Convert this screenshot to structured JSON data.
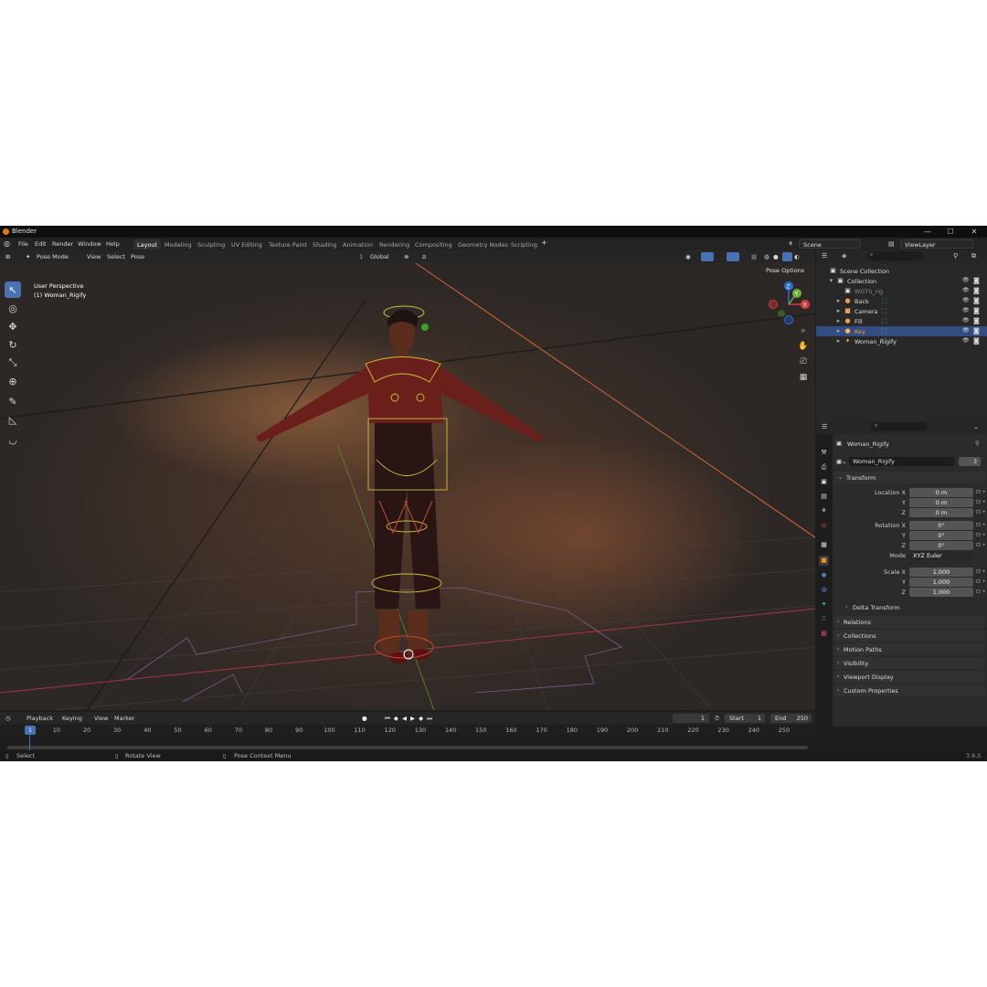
{
  "window": {
    "title": "Blender",
    "minimize": "—",
    "maximize": "☐",
    "close": "✕"
  },
  "menu": [
    "File",
    "Edit",
    "Render",
    "Window",
    "Help"
  ],
  "workspaces": [
    "Layout",
    "Modeling",
    "Sculpting",
    "UV Editing",
    "Texture Paint",
    "Shading",
    "Animation",
    "Rendering",
    "Compositing",
    "Geometry Nodes",
    "Scripting"
  ],
  "active_workspace": "Layout",
  "add_workspace": "+",
  "scene_field": "Scene",
  "view_layer_field": "ViewLayer",
  "viewport_header": {
    "mode": "Pose Mode",
    "menus": [
      "View",
      "Select",
      "Pose"
    ],
    "orientation": "Global",
    "pose_options": "Pose Options"
  },
  "viewport": {
    "perspective": "User Perspective",
    "object": "(1) Woman_Rigify",
    "gizmo": {
      "z": "Z",
      "y": "Y",
      "x": "X"
    }
  },
  "tools": [
    {
      "name": "select-box-tool",
      "glyph": "↖",
      "active": true
    },
    {
      "name": "cursor-tool",
      "glyph": "◎",
      "active": false
    },
    {
      "name": "move-tool",
      "glyph": "✥",
      "active": false
    },
    {
      "name": "rotate-tool",
      "glyph": "↻",
      "active": false
    },
    {
      "name": "scale-tool",
      "glyph": "⤡",
      "active": false
    },
    {
      "name": "transform-tool",
      "glyph": "⊕",
      "active": false
    },
    {
      "name": "annotate-tool",
      "glyph": "✎",
      "active": false
    },
    {
      "name": "measure-tool",
      "glyph": "◺",
      "active": false
    },
    {
      "name": "bend-tool",
      "glyph": "◡",
      "active": false
    }
  ],
  "timeline": {
    "menus": [
      "Playback",
      "Keying",
      "View",
      "Marker"
    ],
    "current_frame": "1",
    "start_label": "Start",
    "start": "1",
    "end_label": "End",
    "end": "250",
    "ticks": [
      "1",
      "10",
      "20",
      "30",
      "40",
      "50",
      "60",
      "70",
      "80",
      "90",
      "100",
      "110",
      "120",
      "130",
      "140",
      "150",
      "160",
      "170",
      "180",
      "190",
      "200",
      "210",
      "220",
      "230",
      "240",
      "250"
    ]
  },
  "statusbar": {
    "select": "Select",
    "rotate": "Rotate View",
    "context": "Pose Context Menu",
    "version": "3.6.5"
  },
  "outliner": {
    "rows": [
      {
        "label": "Scene Collection",
        "indent": 0,
        "icon": "▣",
        "color": "#dedede"
      },
      {
        "label": "Collection",
        "indent": 1,
        "icon": "▣",
        "color": "#dedede"
      },
      {
        "label": "WGTS_rig",
        "indent": 2,
        "icon": "▣",
        "color": "#8a8a8a"
      },
      {
        "label": "Back",
        "indent": 2,
        "icon": "●",
        "color": "#dedede"
      },
      {
        "label": "Camera",
        "indent": 2,
        "icon": "■",
        "color": "#dedede"
      },
      {
        "label": "Fill",
        "indent": 2,
        "icon": "●",
        "color": "#dedede"
      },
      {
        "label": "Key",
        "indent": 2,
        "icon": "●",
        "color": "#ff9a3a",
        "selected": true
      },
      {
        "label": "Woman_Rigify",
        "indent": 2,
        "icon": "✦",
        "color": "#dedede"
      }
    ]
  },
  "properties": {
    "object_name": "Woman_Rigify",
    "data_name": "Woman_Rigify",
    "users": "3",
    "transform_label": "Transform",
    "location": {
      "label": "Location X",
      "x": "0 m",
      "y": "0 m",
      "z": "0 m"
    },
    "rotation": {
      "label": "Rotation X",
      "x": "0°",
      "y": "0°",
      "z": "0°"
    },
    "mode_label": "Mode",
    "mode": "XYZ Euler",
    "scale": {
      "label": "Scale X",
      "x": "1.000",
      "y": "1.000",
      "z": "1.000"
    },
    "axis_y": "Y",
    "axis_z": "Z",
    "delta": "Delta Transform",
    "panels": [
      "Relations",
      "Collections",
      "Motion Paths",
      "Visibility",
      "Viewport Display",
      "Custom Properties"
    ]
  }
}
